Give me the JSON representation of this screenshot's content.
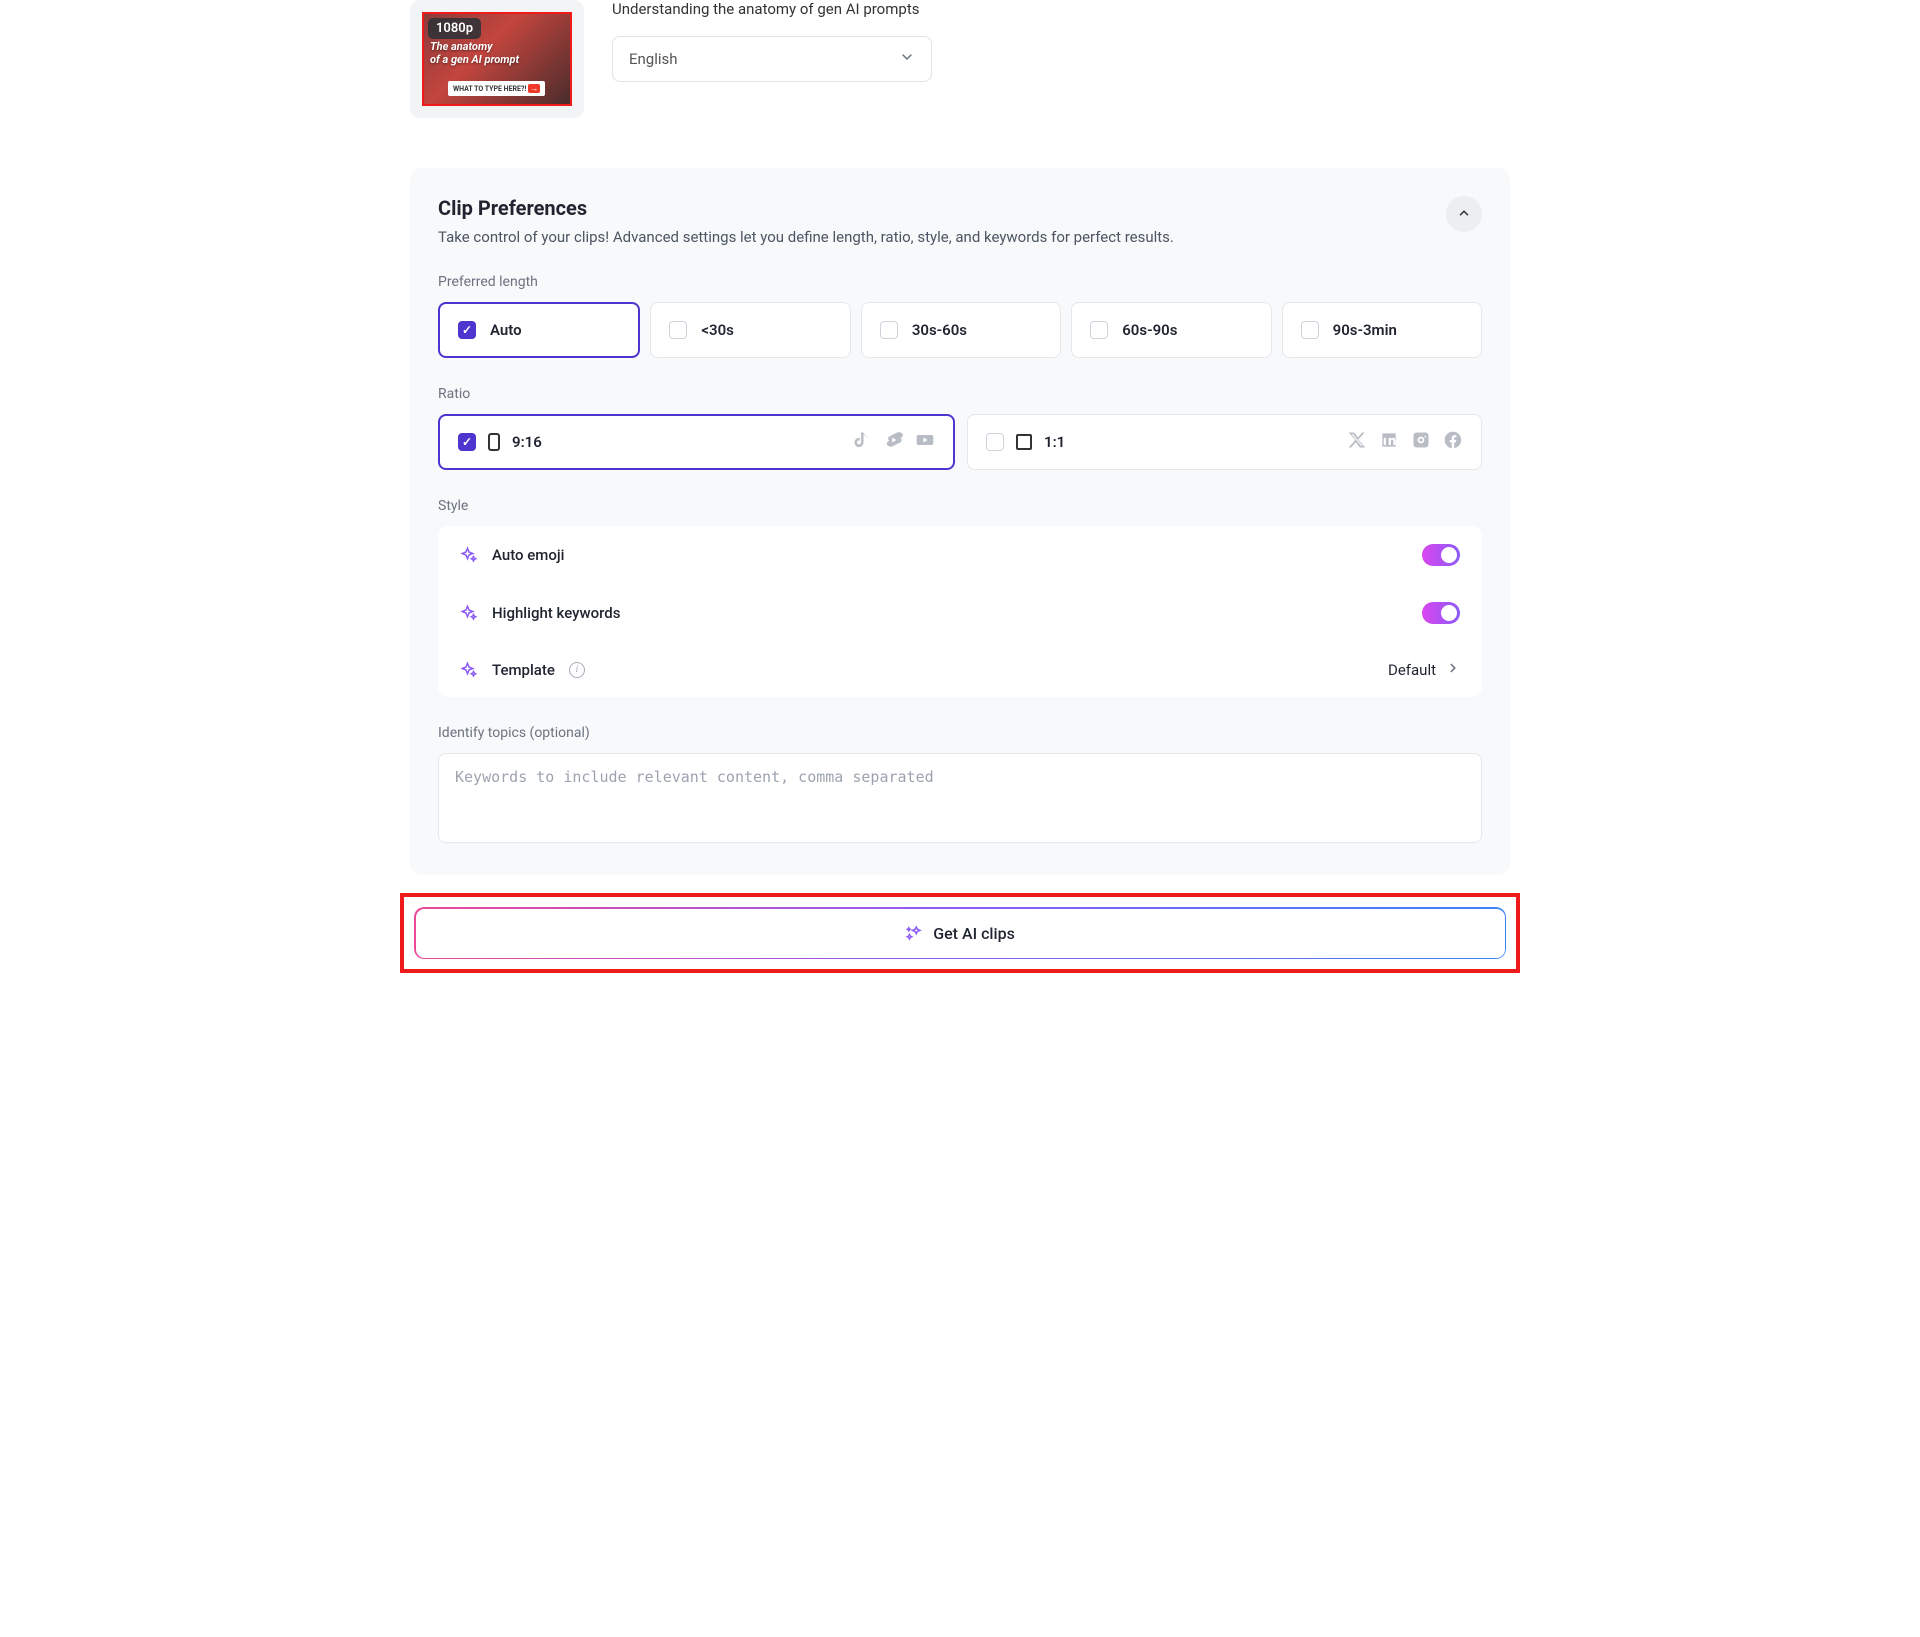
{
  "video": {
    "title": "Understanding the anatomy of gen AI prompts",
    "resolution_badge": "1080p",
    "thumb_line1": "The anatomy",
    "thumb_line2": "of a gen AI prompt",
    "thumb_cta": "WHAT TO TYPE HERE?!"
  },
  "language": {
    "selected": "English"
  },
  "preferences": {
    "title": "Clip Preferences",
    "subtitle": "Take control of your clips! Advanced settings let you define length, ratio, style, and keywords for perfect results.",
    "length_label": "Preferred length",
    "length_options": [
      "Auto",
      "<30s",
      "30s-60s",
      "60s-90s",
      "90s-3min"
    ],
    "ratio_label": "Ratio",
    "ratio_options": {
      "portrait": "9:16",
      "square": "1:1"
    },
    "style_label": "Style",
    "style": {
      "auto_emoji": "Auto emoji",
      "highlight_keywords": "Highlight keywords",
      "template_label": "Template",
      "template_value": "Default"
    },
    "topics_label": "Identify topics (optional)",
    "topics_placeholder": "Keywords to include relevant content, comma separated"
  },
  "cta": {
    "label": "Get AI clips"
  }
}
